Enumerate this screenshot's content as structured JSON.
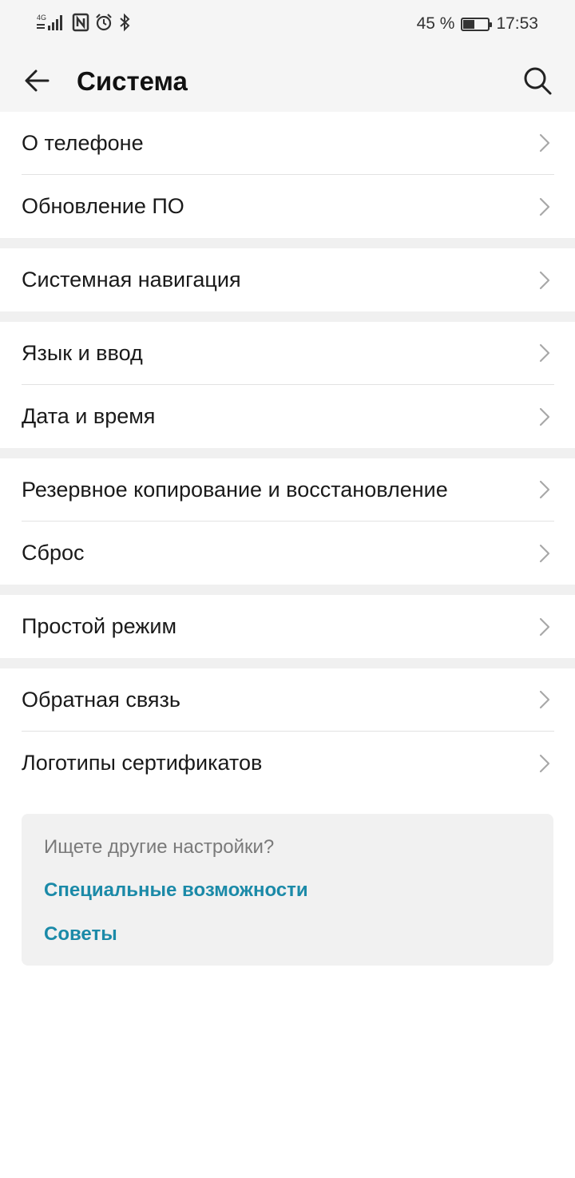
{
  "status_bar": {
    "network_label": "4G",
    "battery_percent": "45 %",
    "battery_level": 0.45,
    "time": "17:53",
    "icons": [
      "signal-icon",
      "nfc-icon",
      "alarm-icon",
      "bluetooth-icon",
      "battery-icon"
    ]
  },
  "header": {
    "title": "Система",
    "back_icon": "arrow-left-icon",
    "search_icon": "search-icon"
  },
  "groups": [
    {
      "items": [
        "О телефоне",
        "Обновление ПО"
      ]
    },
    {
      "items": [
        "Системная навигация"
      ]
    },
    {
      "items": [
        "Язык и ввод",
        "Дата и время"
      ]
    },
    {
      "items": [
        "Резервное копирование и восстановление",
        "Сброс"
      ]
    },
    {
      "items": [
        "Простой режим"
      ]
    },
    {
      "items": [
        "Обратная связь",
        "Логотипы сертификатов"
      ]
    }
  ],
  "more_settings": {
    "hint": "Ищете другие настройки?",
    "links": [
      "Специальные возможности",
      "Советы"
    ],
    "link_color": "#1b8aa8"
  }
}
